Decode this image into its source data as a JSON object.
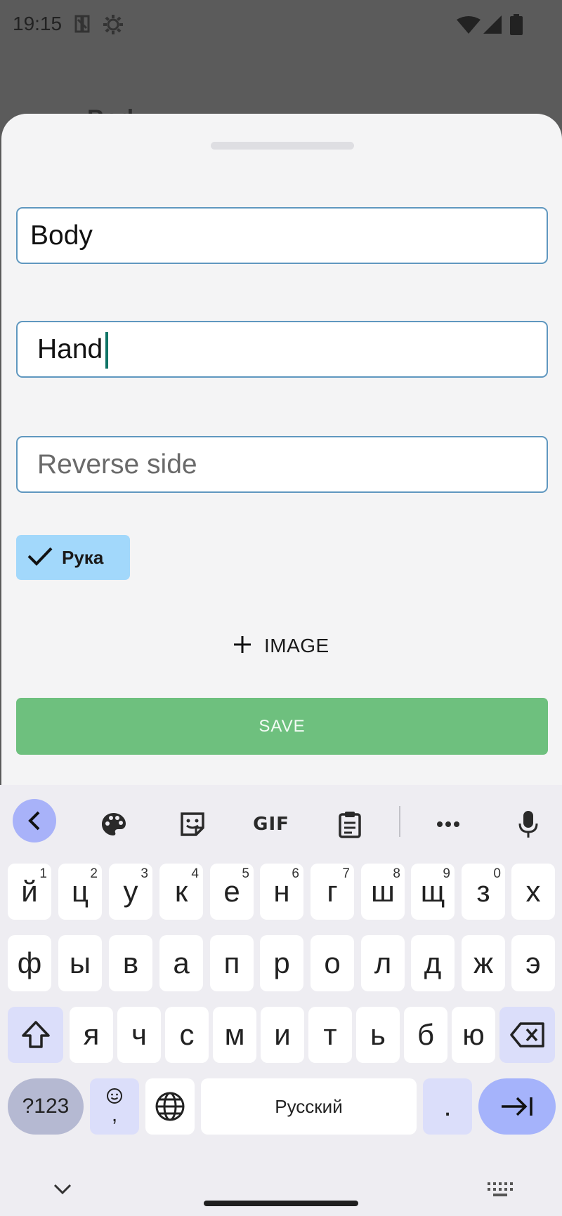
{
  "status_bar": {
    "time": "19:15",
    "icons": [
      "nfc-icon",
      "settings-gear-icon",
      "wifi-icon",
      "cellular-signal-icon",
      "battery-icon"
    ]
  },
  "background": {
    "title": "Body"
  },
  "sheet": {
    "front_field": {
      "value": "Body",
      "placeholder": ""
    },
    "back_field": {
      "value": "Hand",
      "placeholder": ""
    },
    "reverse_field": {
      "value": "",
      "placeholder": "Reverse side"
    },
    "tag_chip": {
      "label": "Рука",
      "selected": true
    },
    "add_image_label": "IMAGE",
    "save_label": "SAVE"
  },
  "keyboard": {
    "toolbar": [
      "back-icon",
      "palette-icon",
      "sticker-icon",
      "gif",
      "clipboard-icon",
      "more-icon",
      "mic-icon"
    ],
    "gif_label": "GIF",
    "row1": [
      {
        "k": "й",
        "n": "1"
      },
      {
        "k": "ц",
        "n": "2"
      },
      {
        "k": "у",
        "n": "3"
      },
      {
        "k": "к",
        "n": "4"
      },
      {
        "k": "е",
        "n": "5"
      },
      {
        "k": "н",
        "n": "6"
      },
      {
        "k": "г",
        "n": "7"
      },
      {
        "k": "ш",
        "n": "8"
      },
      {
        "k": "щ",
        "n": "9"
      },
      {
        "k": "з",
        "n": "0"
      },
      {
        "k": "х",
        "n": ""
      }
    ],
    "row2": [
      "ф",
      "ы",
      "в",
      "а",
      "п",
      "р",
      "о",
      "л",
      "д",
      "ж",
      "э"
    ],
    "row3": [
      "я",
      "ч",
      "с",
      "м",
      "и",
      "т",
      "ь",
      "б",
      "ю"
    ],
    "symbols_label": "?123",
    "emoji_comma": ",",
    "space_label": "Русский",
    "period_label": "."
  },
  "colors": {
    "field_border": "#5f97bf",
    "chip_bg": "#a2d8fb",
    "save_bg": "#6ec07e",
    "keyboard_bg": "#eeedf2",
    "accent_key": "#a5b3fb"
  }
}
